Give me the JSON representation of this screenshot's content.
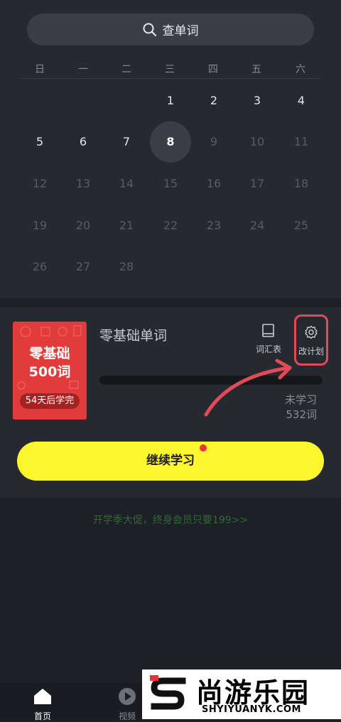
{
  "search": {
    "label": "查单词"
  },
  "weekdays": [
    "日",
    "一",
    "二",
    "三",
    "四",
    "五",
    "六"
  ],
  "calendar": {
    "days": [
      "1",
      "2",
      "3",
      "4",
      "5",
      "6",
      "7",
      "8",
      "9",
      "10",
      "11",
      "12",
      "13",
      "14",
      "15",
      "16",
      "17",
      "18",
      "19",
      "20",
      "21",
      "22",
      "23",
      "24",
      "25",
      "26",
      "27",
      "28"
    ],
    "today": "8"
  },
  "book": {
    "cover_line1": "零基础",
    "cover_line2": "500词",
    "cover_badge": "54天后学完",
    "title": "零基础单词",
    "vocab_label": "词汇表",
    "plan_label": "改计划",
    "unlearned_label": "未学习",
    "unlearned_count": "532词",
    "progress": 0
  },
  "continue_button": "继续学习",
  "promo": "开学季大促，终身会员只要199>>",
  "tabs": [
    {
      "label": "首页",
      "active": true
    },
    {
      "label": "视频",
      "active": false
    }
  ],
  "watermark": {
    "cn": "尚游乐园",
    "en": "SHYIYUANYK.COM"
  },
  "colors": {
    "accent_yellow": "#fdf52e",
    "cover_red": "#e23b3b",
    "annotation": "#e24a55"
  }
}
